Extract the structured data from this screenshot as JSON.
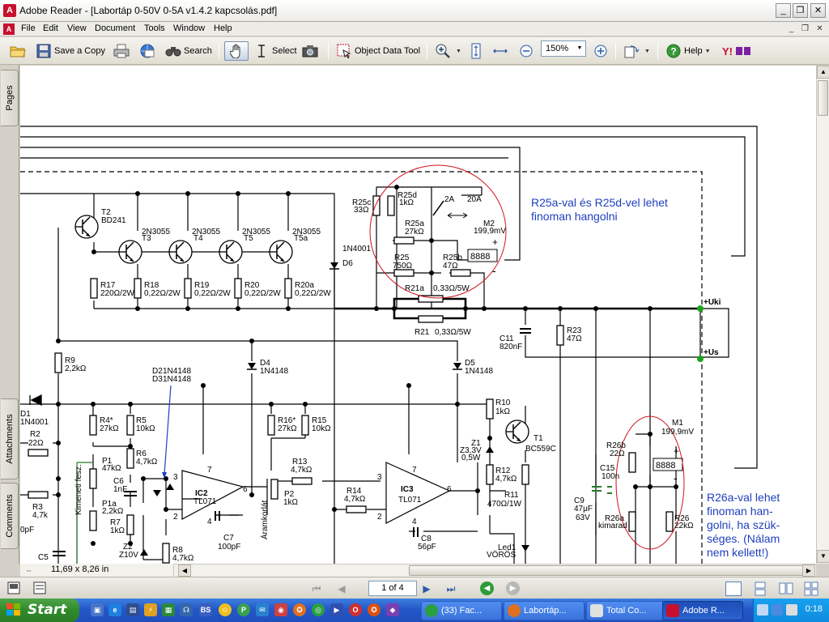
{
  "window": {
    "title": "Adobe Reader - [Labortáp 0-50V 0-5A v1.4.2 kapcsolás.pdf]"
  },
  "menu": {
    "items": [
      "File",
      "Edit",
      "View",
      "Document",
      "Tools",
      "Window",
      "Help"
    ]
  },
  "toolbar": {
    "save_copy_label": "Save a Copy",
    "search_label": "Search",
    "select_label": "Select",
    "object_data_label": "Object Data Tool",
    "zoom_value": "150%",
    "help_label": "Help"
  },
  "side_tabs": {
    "pages": "Pages",
    "attachments": "Attachments",
    "comments": "Comments"
  },
  "status": {
    "page_size": "11,69 x 8,26 in",
    "page_indicator": "1 of 4"
  },
  "schematic": {
    "labels": {
      "t2": "T2",
      "t2_type": "BD241",
      "t3": "T3",
      "t3_type": "2N3055",
      "t4": "T4",
      "t4_type": "2N3055",
      "t5": "T5",
      "t5_type": "2N3055",
      "t5a": "T5a",
      "t5a_type": "2N3055",
      "r17": "R17",
      "r17_val": "220Ω/2W",
      "r18": "R18",
      "r18_val": "0,22Ω/2W",
      "r19": "R19",
      "r19_val": "0,22Ω/2W",
      "r20": "R20",
      "r20_val": "0,22Ω/2W",
      "r20a": "R20a",
      "r20a_val": "0,22Ω/2W",
      "d6": "D6",
      "d6_type": "1N4001",
      "r25c": "R25c",
      "r25c_val": "33Ω",
      "r25d": "R25d",
      "r25d_val": "1kΩ",
      "sw_2a": "2A",
      "sw_20a": "20A",
      "r25a": "R25a",
      "r25a_val": "27kΩ",
      "m2": "M2",
      "m2_val": "199,9mV",
      "r25": "R25",
      "r25_val": "750Ω",
      "r25b": "R25b",
      "r25b_val": "47Ω",
      "r21a": "R21a",
      "r21a_val": "0,33Ω/5W",
      "r21": "R21",
      "r21_val": "0,33Ω/5W",
      "note_top": "R25a-val és R25d-vel lehet",
      "note_top2": "finoman hangolni",
      "uki": "+Uki",
      "us": "+Us",
      "c11": "C11",
      "c11_val": "820nF",
      "r23": "R23",
      "r23_val": "47Ω",
      "r9": "R9",
      "r9_val": "2,2kΩ",
      "d4": "D4",
      "d4_type": "1N4148",
      "d5": "D5",
      "d5_type": "1N4148",
      "d2": "D2",
      "d2_type": "1N4148",
      "d3": "D3",
      "d3_type": "1N4148",
      "d1": "D1",
      "d1_type": "1N4001",
      "r4": "R4*",
      "r4_val": "27kΩ",
      "r5": "R5",
      "r5_val": "10kΩ",
      "r16": "R16*",
      "r16_val": "27kΩ",
      "r15": "R15",
      "r15_val": "10kΩ",
      "r10": "R10",
      "r10_val": "1kΩ",
      "t1": "T1",
      "t1_type": "BC559C",
      "z1": "Z1",
      "z1_val": "Z3,3V",
      "z1_val2": "0,5W",
      "r12": "R12",
      "r12_val": "4,7kΩ",
      "r11": "R11",
      "r11_val": "470Ω/1W",
      "led1": "Led1",
      "led1_val": "VÖRÖS",
      "r2": "R2",
      "r2_val": "22Ω",
      "r3": "R3",
      "r3_val": "4,7k",
      "p1": "P1",
      "p1_val": "47kΩ",
      "p1a": "P1a",
      "p1a_val": "2,2kΩ",
      "r6": "R6",
      "r6_val": "4,7kΩ",
      "c6": "C6",
      "c6_val": "1nF",
      "r7": "R7",
      "r7_val": "1kΩ",
      "z2": "Z2",
      "z2_val": "Z10V",
      "r8": "R8",
      "r8_val": "4,7kΩ",
      "c5": "C5",
      "c0": "0pF",
      "ic2": "IC2",
      "ic2_type": "TL071",
      "c7": "C7",
      "c7_val": "100pF",
      "r13": "R13",
      "r13_val": "4,7kΩ",
      "p2": "P2",
      "p2_val": "1kΩ",
      "r14": "R14",
      "r14_val": "4,7kΩ",
      "ic3": "IC3",
      "ic3_type": "TL071",
      "c8": "C8",
      "c8_val": "56pF",
      "voltage_adj": "Kimeneti fesz.",
      "current_limit": "Áramkorlát",
      "m1": "M1",
      "m1_val": "199,9mV",
      "r26b": "R26b",
      "r26b_val": "22Ω",
      "c15": "C15",
      "c15_val": "100n",
      "c9": "C9",
      "c9_val": "47μF",
      "c9_val2": "63V",
      "r26a": "R26a",
      "r26a_val": "kimarad",
      "r26": "R26",
      "r26_val": "22kΩ",
      "note_bottom1": "R26a-val lehet",
      "note_bottom2": "finoman han-",
      "note_bottom3": "golni, ha szük-",
      "note_bottom4": "séges. (Nálam",
      "note_bottom5": "nem kellett!)",
      "pin3a": "3",
      "pin2a": "2",
      "pin7a": "7",
      "pin4a": "4",
      "pin6a": "6",
      "pin3b": "3",
      "pin2b": "2",
      "pin7b": "7",
      "pin4b": "4",
      "pin6b": "6",
      "plus_m2": "+",
      "minus_m2": "-",
      "plus_m1": "+",
      "minus_m1": "-",
      "display_m2": "8888",
      "display_m1": "8888"
    }
  },
  "taskbar": {
    "start_label": "Start",
    "tasks": [
      "(33) Fac...",
      "Labortáp...",
      "Total Co...",
      "Adobe R..."
    ],
    "clock": "0:18"
  },
  "colors": {
    "note_blue": "#1f3fbf",
    "highlight_red": "#d0141e",
    "taskbar_blue": "#2457c8"
  }
}
